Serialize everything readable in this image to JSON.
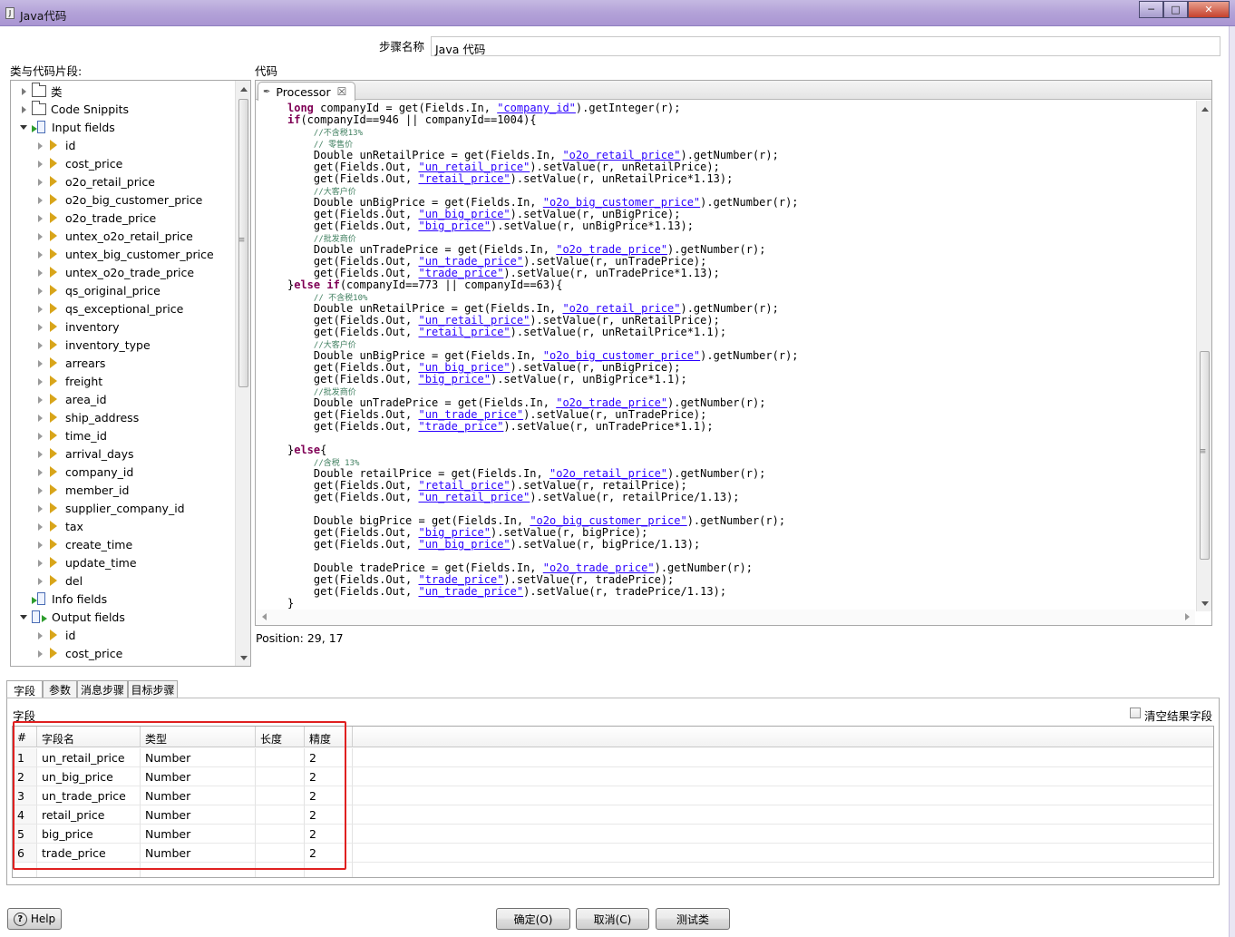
{
  "window": {
    "title": "Java代码",
    "min": "─",
    "max": "□",
    "close": "✕"
  },
  "step": {
    "label": "步骤名称",
    "value": "Java 代码"
  },
  "left": {
    "label": "类与代码片段:"
  },
  "code_label": "代码",
  "tree": {
    "classes": "类",
    "snippets": "Code Snippits",
    "input_fields": "Input fields",
    "input_items": [
      "id",
      "cost_price",
      "o2o_retail_price",
      "o2o_big_customer_price",
      "o2o_trade_price",
      "untex_o2o_retail_price",
      "untex_big_customer_price",
      "untex_o2o_trade_price",
      "qs_original_price",
      "qs_exceptional_price",
      "inventory",
      "inventory_type",
      "arrears",
      "freight",
      "area_id",
      "ship_address",
      "time_id",
      "arrival_days",
      "company_id",
      "member_id",
      "supplier_company_id",
      "tax",
      "create_time",
      "update_time",
      "del"
    ],
    "info_fields": "Info fields",
    "output_fields": "Output fields",
    "output_items": [
      "id",
      "cost_price"
    ]
  },
  "editor": {
    "tab": "Processor",
    "lines": [
      "long companyId = get(Fields.In, \"company_id\").getInteger(r);",
      "if(companyId==946 || companyId==1004){",
      "    //不含税13%",
      "    // 零售价",
      "    Double unRetailPrice = get(Fields.In, \"o2o_retail_price\").getNumber(r);",
      "    get(Fields.Out, \"un_retail_price\").setValue(r, unRetailPrice);",
      "    get(Fields.Out, \"retail_price\").setValue(r, unRetailPrice*1.13);",
      "    //大客户价",
      "    Double unBigPrice = get(Fields.In, \"o2o_big_customer_price\").getNumber(r);",
      "    get(Fields.Out, \"un_big_price\").setValue(r, unBigPrice);",
      "    get(Fields.Out, \"big_price\").setValue(r, unBigPrice*1.13);",
      "    //批发商价",
      "    Double unTradePrice = get(Fields.In, \"o2o_trade_price\").getNumber(r);",
      "    get(Fields.Out, \"un_trade_price\").setValue(r, unTradePrice);",
      "    get(Fields.Out, \"trade_price\").setValue(r, unTradePrice*1.13);",
      "}else if(companyId==773 || companyId==63){",
      "    // 不含税10%",
      "    Double unRetailPrice = get(Fields.In, \"o2o_retail_price\").getNumber(r);",
      "    get(Fields.Out, \"un_retail_price\").setValue(r, unRetailPrice);",
      "    get(Fields.Out, \"retail_price\").setValue(r, unRetailPrice*1.1);",
      "    //大客户价",
      "    Double unBigPrice = get(Fields.In, \"o2o_big_customer_price\").getNumber(r);",
      "    get(Fields.Out, \"un_big_price\").setValue(r, unBigPrice);",
      "    get(Fields.Out, \"big_price\").setValue(r, unBigPrice*1.1);",
      "    //批发商价",
      "    Double unTradePrice = get(Fields.In, \"o2o_trade_price\").getNumber(r);",
      "    get(Fields.Out, \"un_trade_price\").setValue(r, unTradePrice);",
      "    get(Fields.Out, \"trade_price\").setValue(r, unTradePrice*1.1);",
      "",
      "}else{",
      "    //含税 13%",
      "    Double retailPrice = get(Fields.In, \"o2o_retail_price\").getNumber(r);",
      "    get(Fields.Out, \"retail_price\").setValue(r, retailPrice);",
      "    get(Fields.Out, \"un_retail_price\").setValue(r, retailPrice/1.13);",
      "",
      "    Double bigPrice = get(Fields.In, \"o2o_big_customer_price\").getNumber(r);",
      "    get(Fields.Out, \"big_price\").setValue(r, bigPrice);",
      "    get(Fields.Out, \"un_big_price\").setValue(r, bigPrice/1.13);",
      "",
      "    Double tradePrice = get(Fields.In, \"o2o_trade_price\").getNumber(r);",
      "    get(Fields.Out, \"trade_price\").setValue(r, tradePrice);",
      "    get(Fields.Out, \"un_trade_price\").setValue(r, tradePrice/1.13);",
      "}"
    ],
    "position": "Position: 29, 17"
  },
  "bottom_tabs": [
    "字段",
    "参数",
    "消息步骤",
    "目标步骤"
  ],
  "fields_panel": {
    "label": "字段",
    "clear_label": "清空结果字段",
    "columns": [
      "#",
      "字段名",
      "类型",
      "长度",
      "精度"
    ],
    "rows": [
      [
        "1",
        "un_retail_price",
        "Number",
        "",
        "2"
      ],
      [
        "2",
        "un_big_price",
        "Number",
        "",
        "2"
      ],
      [
        "3",
        "un_trade_price",
        "Number",
        "",
        "2"
      ],
      [
        "4",
        "retail_price",
        "Number",
        "",
        "2"
      ],
      [
        "5",
        "big_price",
        "Number",
        "",
        "2"
      ],
      [
        "6",
        "trade_price",
        "Number",
        "",
        "2"
      ]
    ]
  },
  "buttons": {
    "help": "Help",
    "ok": "确定(O)",
    "cancel": "取消(C)",
    "test": "测试类"
  },
  "colors": {
    "keyword": "#7f0055",
    "string": "#2a00ff",
    "comment": "#3f7f5f",
    "highlight": "#e02020"
  }
}
